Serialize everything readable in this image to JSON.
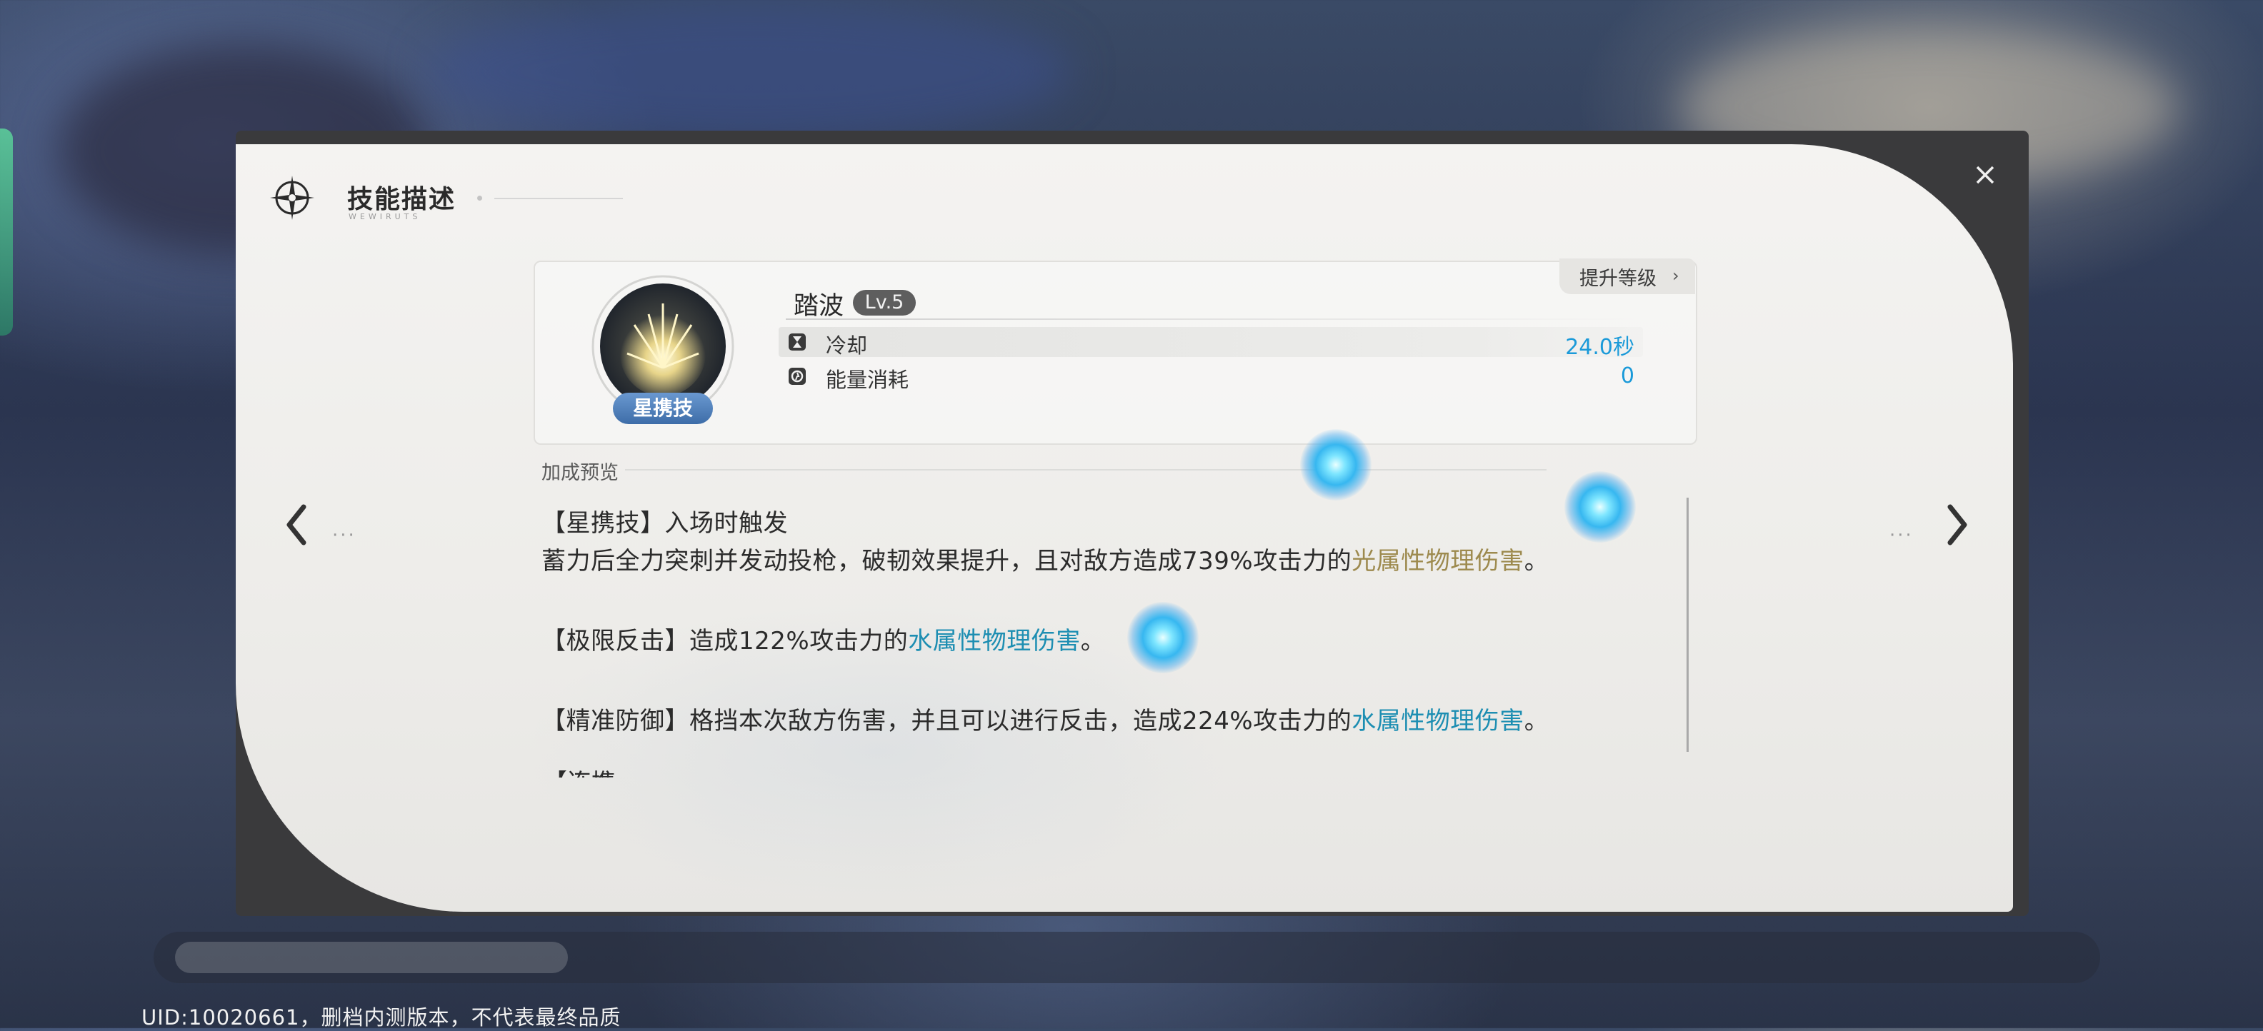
{
  "dialog": {
    "title": "技能描述",
    "subtitle": "WEWIRUTS",
    "close_label": "×"
  },
  "skill": {
    "name": "踏波",
    "level": "Lv.5",
    "type_badge": "星携技",
    "upgrade_label": "提升等级",
    "upgrade_chevron": "›",
    "stats": [
      {
        "icon": "hourglass-icon",
        "label": "冷却",
        "value": "24.0秒"
      },
      {
        "icon": "energy-icon",
        "label": "能量消耗",
        "value": "0"
      }
    ]
  },
  "bonus_preview_label": "加成预览",
  "description": {
    "line1": "【星携技】入场时触发",
    "line2_a": "蓄力后全力突刺并发动投枪，破韧效果提升，且对敌方造成739%攻击力的",
    "line2_b": "光属性物理伤害",
    "line2_c": "。",
    "line3_a": "【极限反击】造成122%攻击力的",
    "line3_b": "水属性物理伤害",
    "line3_c": "。",
    "line4_a": "【精准防御】格挡本次敌方伤害，并且可以进行反击，造成224%攻击力的",
    "line4_b": "水属性物理伤害",
    "line4_c": "。",
    "line5_cut": "【连携"
  },
  "nav": {
    "prev_dots": "···",
    "next_dots": "···"
  },
  "footer": {
    "uid_text": "UID:10020661，删档内测版本，不代表最终品质"
  },
  "colors": {
    "accent_value": "#1b9ad9",
    "light_damage": "#9d8a4e",
    "water_damage": "#1d8eb2",
    "badge": "#3d6da8"
  }
}
